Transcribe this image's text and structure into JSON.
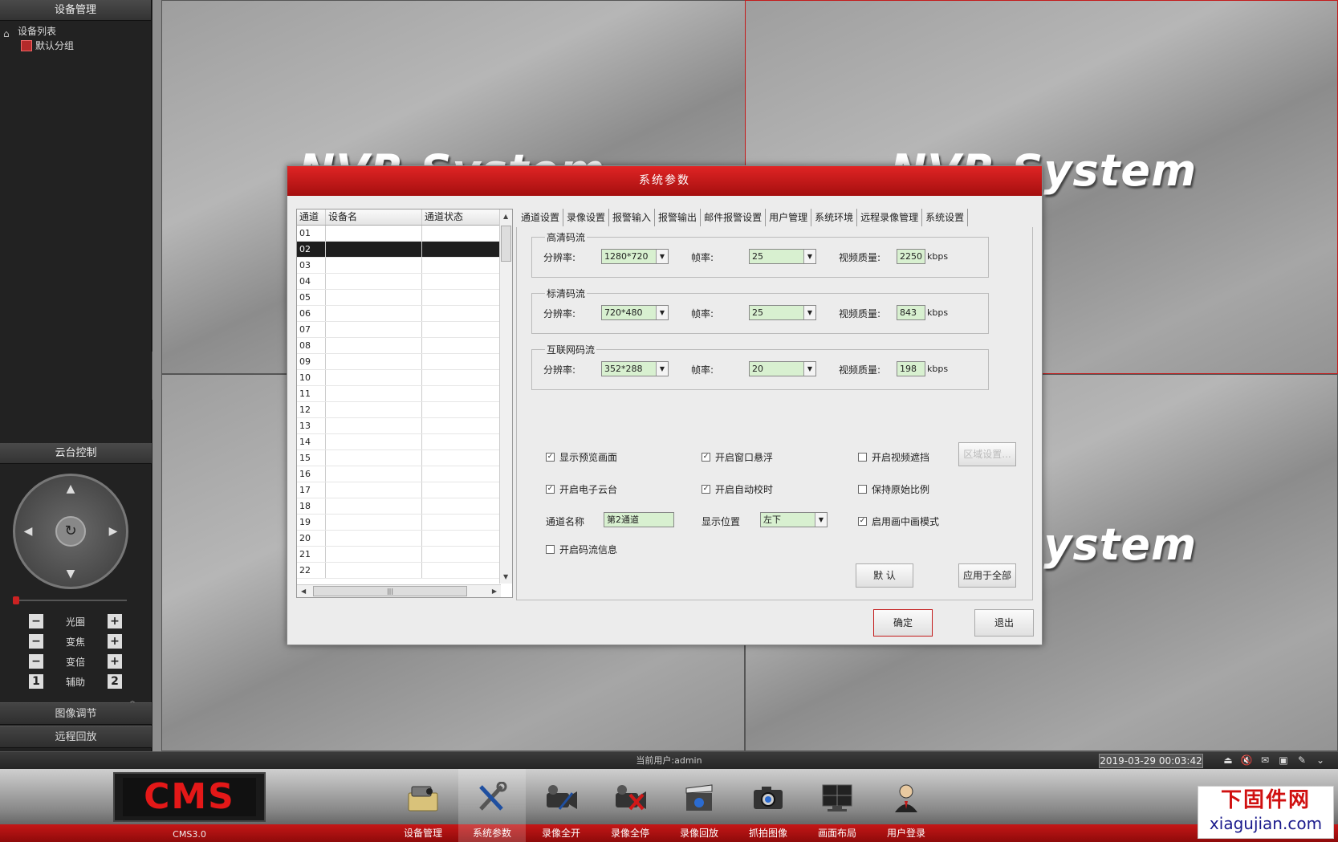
{
  "sidebar": {
    "title": "设备管理",
    "tree": {
      "root": "设备列表",
      "child": "默认分组"
    },
    "collapse_glyph": "«",
    "ptz_title": "云台控制",
    "ptz_rows": [
      {
        "minus": "−",
        "label": "光圈",
        "plus": "+"
      },
      {
        "minus": "−",
        "label": "变焦",
        "plus": "+"
      },
      {
        "minus": "−",
        "label": "变倍",
        "plus": "+"
      },
      {
        "minus": "1",
        "label": "辅助",
        "plus": "2"
      }
    ],
    "image_adjust": "图像调节",
    "remote_playback": "远程回放"
  },
  "watermark_text": "NVR System",
  "dialog": {
    "title": "系统参数",
    "channel_list": {
      "headers": [
        "通道",
        "设备名",
        "通道状态"
      ],
      "rows": [
        "01",
        "02",
        "03",
        "04",
        "05",
        "06",
        "07",
        "08",
        "09",
        "10",
        "11",
        "12",
        "13",
        "14",
        "15",
        "16",
        "17",
        "18",
        "19",
        "20",
        "21",
        "22"
      ],
      "selected": "02"
    },
    "tabs": [
      "通道设置",
      "录像设置",
      "报警输入",
      "报警输出",
      "邮件报警设置",
      "用户管理",
      "系统环境",
      "远程录像管理",
      "系统设置"
    ],
    "streams": [
      {
        "title": "高清码流",
        "res_label": "分辨率:",
        "res": "1280*720",
        "fps_label": "帧率:",
        "fps": "25",
        "q_label": "视频质量:",
        "q": "2250",
        "unit": "kbps"
      },
      {
        "title": "标清码流",
        "res_label": "分辨率:",
        "res": "720*480",
        "fps_label": "帧率:",
        "fps": "25",
        "q_label": "视频质量:",
        "q": "843",
        "unit": "kbps"
      },
      {
        "title": "互联网码流",
        "res_label": "分辨率:",
        "res": "352*288",
        "fps_label": "帧率:",
        "fps": "20",
        "q_label": "视频质量:",
        "q": "198",
        "unit": "kbps"
      }
    ],
    "options": {
      "show_preview": {
        "label": "显示预览画面",
        "checked": true
      },
      "window_float": {
        "label": "开启窗口悬浮",
        "checked": true
      },
      "video_mask": {
        "label": "开启视频遮挡",
        "checked": false
      },
      "area_btn": "区域设置...",
      "e_ptz": {
        "label": "开启电子云台",
        "checked": true
      },
      "auto_time": {
        "label": "开启自动校时",
        "checked": true
      },
      "keep_ratio": {
        "label": "保持原始比例",
        "checked": false
      },
      "channel_name_label": "通道名称",
      "channel_name": "第2通道",
      "position_label": "显示位置",
      "position": "左下",
      "pip": {
        "label": "启用画中画模式",
        "checked": true
      },
      "stream_info": {
        "label": "开启码流信息",
        "checked": false
      }
    },
    "default_btn": "默 认",
    "apply_all_btn": "应用于全部",
    "ok_btn": "确定",
    "exit_btn": "退出",
    "check_glyph": "✓",
    "arrow_glyph": "▼"
  },
  "status": {
    "current_user": "当前用户:admin",
    "datetime": "2019-03-29 00:03:42"
  },
  "toolbar": {
    "logo": "CMS",
    "version": "CMS3.0",
    "items": [
      {
        "label": "设备管理",
        "icon": "camera-folder-icon"
      },
      {
        "label": "系统参数",
        "icon": "tools-icon"
      },
      {
        "label": "录像全开",
        "icon": "record-all-on-icon"
      },
      {
        "label": "录像全停",
        "icon": "record-all-stop-icon"
      },
      {
        "label": "录像回放",
        "icon": "clapper-icon"
      },
      {
        "label": "抓拍图像",
        "icon": "snapshot-camera-icon"
      },
      {
        "label": "画面布局",
        "icon": "monitor-layout-icon"
      },
      {
        "label": "用户登录",
        "icon": "user-login-icon"
      }
    ]
  },
  "site_watermark": {
    "cn": "下固件网",
    "url": "xiagujian.com"
  }
}
